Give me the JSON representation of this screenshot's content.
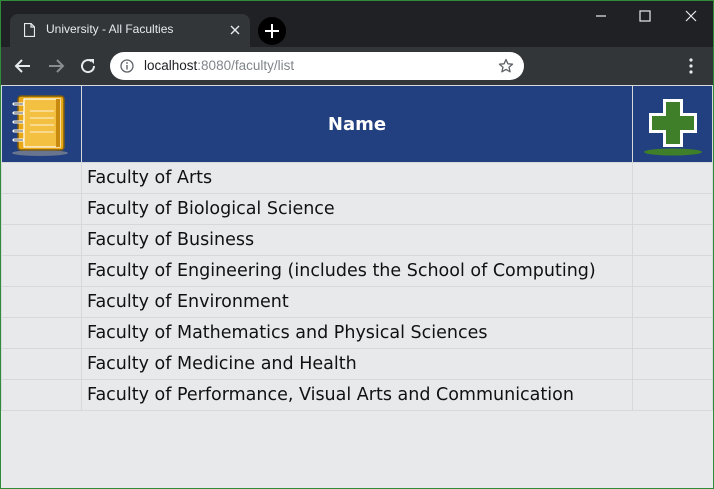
{
  "browser": {
    "tab_title": "University - All Faculties",
    "url_host": "localhost",
    "url_rest": ":8080/faculty/list"
  },
  "table": {
    "header_name": "Name",
    "rows": [
      "Faculty of Arts",
      "Faculty of Biological Science",
      "Faculty of Business",
      "Faculty of Engineering (includes the School of Computing)",
      "Faculty of Environment",
      "Faculty of Mathematics and Physical Sciences",
      "Faculty of Medicine and Health",
      "Faculty of Performance, Visual Arts and Communication"
    ]
  },
  "colors": {
    "header_bg": "#22407f",
    "page_bg": "#e8e9eb",
    "add_icon": "#3f7f2a",
    "notebook_icon": "#e8a818"
  },
  "icons": [
    "document-icon",
    "close-icon",
    "plus-icon",
    "minimize-icon",
    "maximize-icon",
    "window-close-icon",
    "back-arrow-icon",
    "forward-arrow-icon",
    "reload-icon",
    "info-icon",
    "star-icon",
    "kebab-menu-icon",
    "notebook-icon",
    "add-icon"
  ]
}
